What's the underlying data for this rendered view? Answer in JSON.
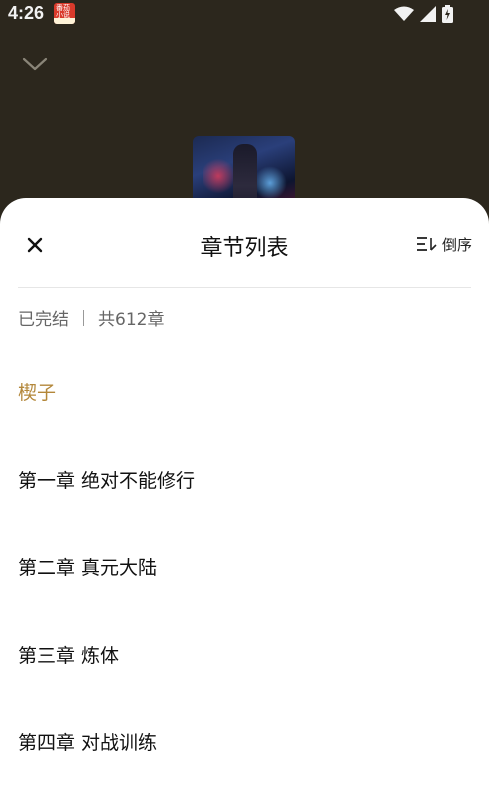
{
  "status_bar": {
    "time": "4:26",
    "app_icon_text": "番茄小说"
  },
  "sheet": {
    "title": "章节列表",
    "sort_label": "倒序",
    "status": "已完结",
    "total": "共612章"
  },
  "chapters": [
    {
      "title": "楔子",
      "current": true
    },
    {
      "title": "第一章 绝对不能修行",
      "current": false
    },
    {
      "title": "第二章 真元大陆",
      "current": false
    },
    {
      "title": "第三章 炼体",
      "current": false
    },
    {
      "title": "第四章 对战训练",
      "current": false
    }
  ],
  "colors": {
    "accent": "#b3873a",
    "overlay": "#2c271d",
    "sheet_bg": "#ffffff"
  },
  "icons": {
    "collapse": "chevron-down-icon",
    "close": "close-icon",
    "sort": "sort-icon",
    "wifi": "wifi-icon",
    "signal": "signal-icon",
    "battery": "battery-icon"
  }
}
